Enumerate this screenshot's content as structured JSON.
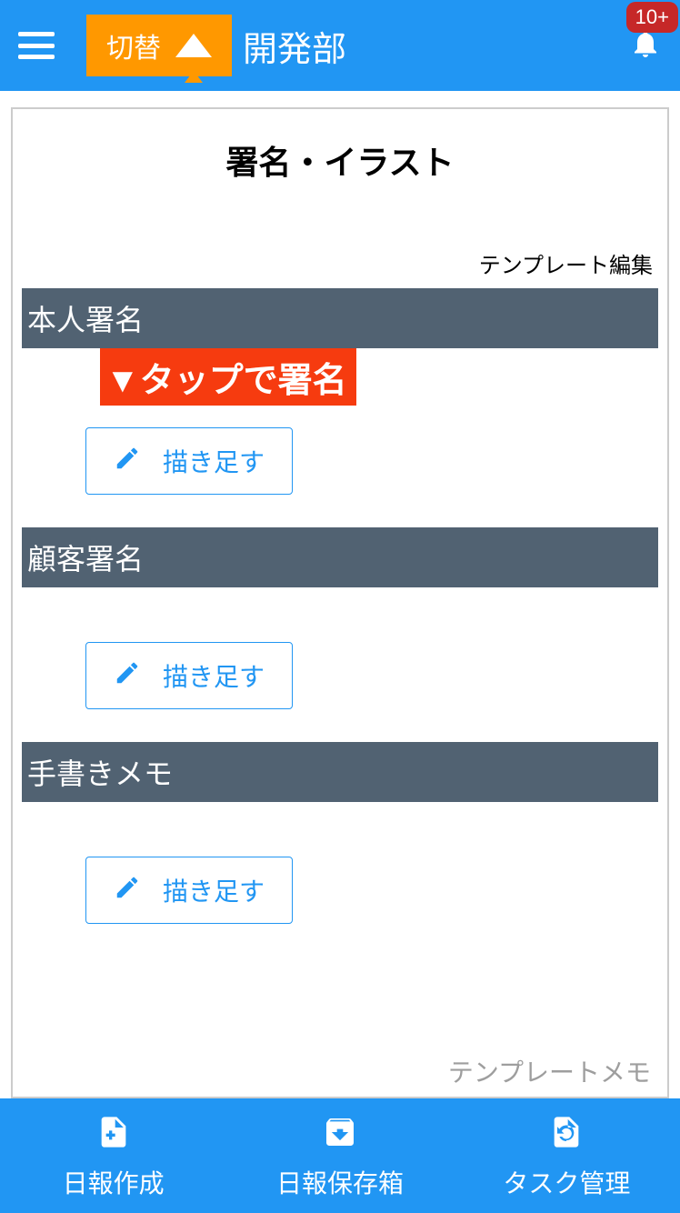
{
  "header": {
    "switch_label": "切替",
    "title": "開発部",
    "badge": "10+"
  },
  "page": {
    "title": "署名・イラスト",
    "template_edit": "テンプレート編集",
    "tap_hint": "▼タップで署名",
    "template_memo": "テンプレートメモ"
  },
  "sections": [
    {
      "header": "本人署名",
      "button": "描き足す",
      "show_hint": true
    },
    {
      "header": "顧客署名",
      "button": "描き足す",
      "show_hint": false
    },
    {
      "header": "手書きメモ",
      "button": "描き足す",
      "show_hint": false
    }
  ],
  "bottom_nav": [
    {
      "label": "日報作成"
    },
    {
      "label": "日報保存箱"
    },
    {
      "label": "タスク管理"
    }
  ]
}
